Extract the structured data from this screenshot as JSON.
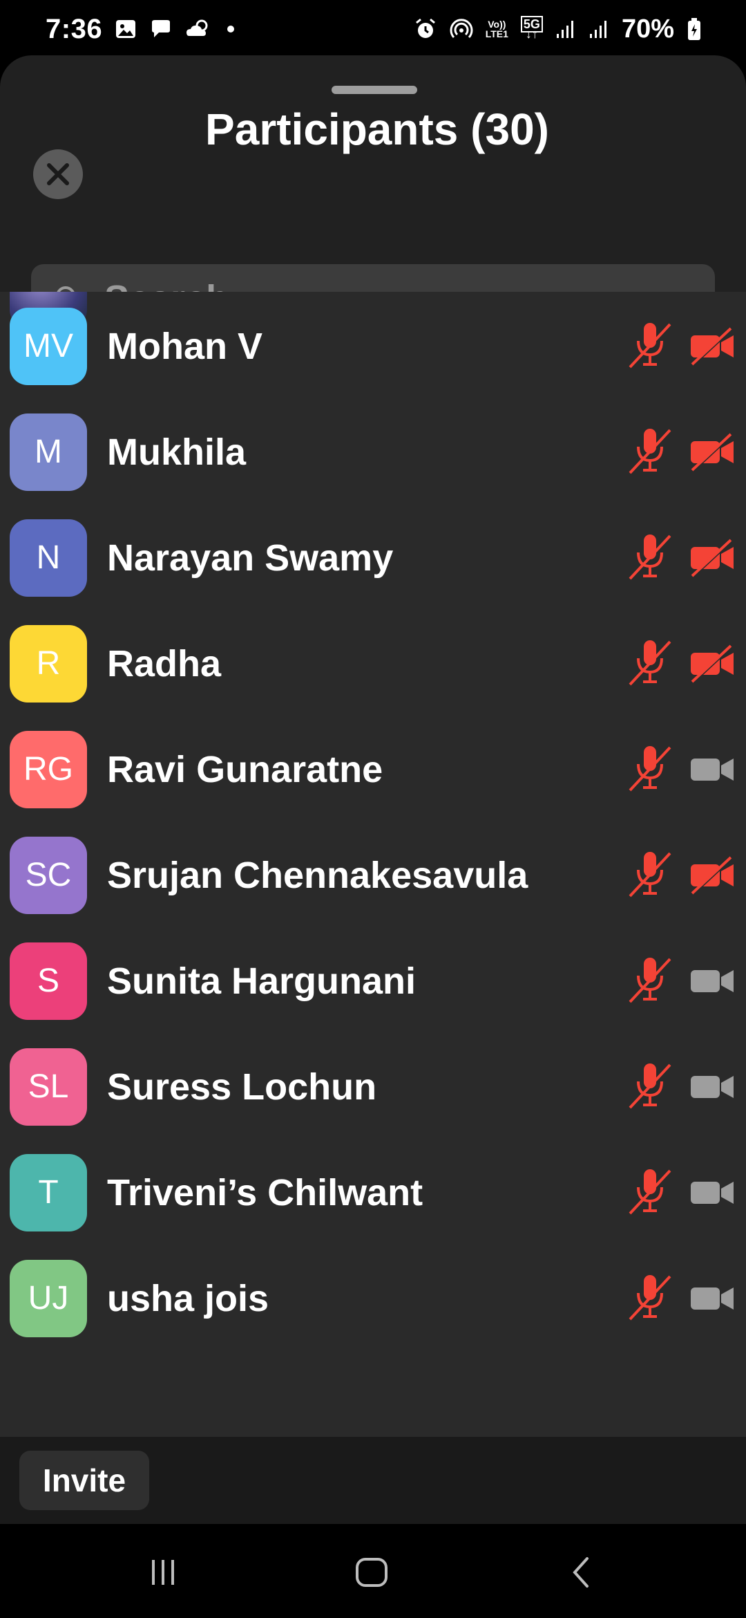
{
  "status_bar": {
    "time": "7:36",
    "battery": "70%",
    "network_label_top": "Vo))",
    "network_label_bottom": "LTE1",
    "network_5g": "5G",
    "left_icons": [
      "image-icon",
      "chat-bubble-icon",
      "weather-cloud-icon",
      "dot-icon"
    ],
    "right_icons": [
      "alarm-icon",
      "hotspot-icon",
      "volte-icon",
      "5g-icon",
      "signal-icon",
      "signal-icon",
      "battery-icon"
    ]
  },
  "sheet": {
    "title": "Participants (30)",
    "close_icon": "close-icon",
    "search": {
      "placeholder": "Search",
      "value": ""
    }
  },
  "participants": [
    {
      "initials": "MV",
      "name": "Mohan V",
      "color": "#4FC3F7",
      "mic_muted": true,
      "video_off": true
    },
    {
      "initials": "M",
      "name": "Mukhila",
      "color": "#7986CB",
      "mic_muted": true,
      "video_off": true
    },
    {
      "initials": "N",
      "name": "Narayan Swamy",
      "color": "#5C6BC0",
      "mic_muted": true,
      "video_off": true
    },
    {
      "initials": "R",
      "name": "Radha",
      "color": "#FDD835",
      "mic_muted": true,
      "video_off": true
    },
    {
      "initials": "RG",
      "name": "Ravi Gunaratne",
      "color": "#FF6B6B",
      "mic_muted": true,
      "video_off": false
    },
    {
      "initials": "SC",
      "name": "Srujan Chennakesavula",
      "color": "#9575CD",
      "mic_muted": true,
      "video_off": true
    },
    {
      "initials": "S",
      "name": "Sunita Hargunani",
      "color": "#EC407A",
      "mic_muted": true,
      "video_off": false
    },
    {
      "initials": "SL",
      "name": "Suress Lochun",
      "color": "#F06292",
      "mic_muted": true,
      "video_off": false
    },
    {
      "initials": "T",
      "name": "Triveni’s Chilwant",
      "color": "#4DB6AC",
      "mic_muted": true,
      "video_off": false
    },
    {
      "initials": "UJ",
      "name": "usha jois",
      "color": "#81C784",
      "mic_muted": true,
      "video_off": false
    }
  ],
  "colors": {
    "muted_red": "#F44336",
    "camera_gray": "#9E9E9E",
    "sheet_bg": "#212121",
    "list_bg": "#2A2A2A"
  },
  "footer": {
    "invite_label": "Invite"
  },
  "nav": {
    "icons": [
      "recents-icon",
      "home-icon",
      "back-icon"
    ]
  }
}
